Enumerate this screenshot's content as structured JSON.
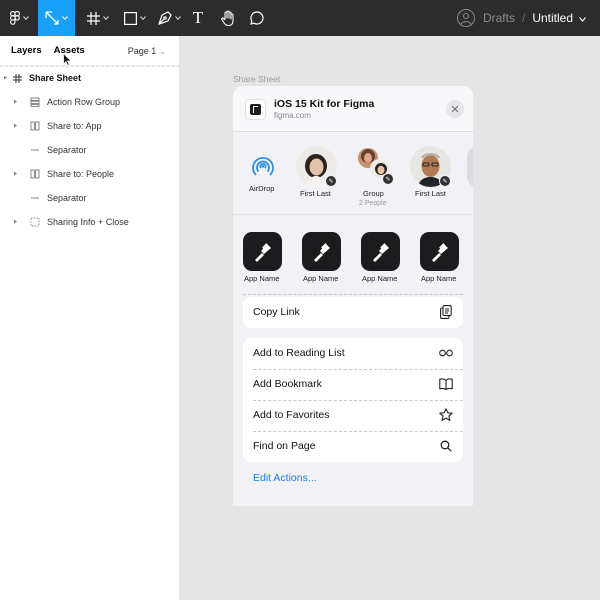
{
  "toolbar": {
    "tools": [
      {
        "name": "main-menu",
        "icon": "figma-logo-icon"
      },
      {
        "name": "move-tool",
        "icon": "move-arrow-icon",
        "active": true
      },
      {
        "name": "frame-tool",
        "icon": "frame-hash-icon"
      },
      {
        "name": "shape-tool",
        "icon": "rectangle-icon"
      },
      {
        "name": "pen-tool",
        "icon": "pen-icon"
      },
      {
        "name": "text-tool",
        "icon": "text-t-icon",
        "glyph": "T"
      },
      {
        "name": "hand-tool",
        "icon": "hand-icon"
      },
      {
        "name": "comment-tool",
        "icon": "comment-bubble-icon"
      }
    ],
    "breadcrumb_root": "Drafts",
    "breadcrumb_sep": "/",
    "file_title": "Untitled",
    "active_color": "#18a0fb",
    "bg_color": "#2c2c2c"
  },
  "left_panel": {
    "tabs": [
      "Layers",
      "Assets"
    ],
    "active_tab": "Assets",
    "page_select": "Page 1",
    "layers": [
      {
        "label": "Share Sheet",
        "kind": "frame",
        "level": 0,
        "expandable": true
      },
      {
        "label": "Action Row Group",
        "kind": "group",
        "level": 1,
        "expandable": true
      },
      {
        "label": "Share to: App",
        "kind": "component",
        "level": 1,
        "expandable": true
      },
      {
        "label": "Separator",
        "kind": "line",
        "level": 1,
        "expandable": false
      },
      {
        "label": "Share to: People",
        "kind": "component",
        "level": 1,
        "expandable": true
      },
      {
        "label": "Separator",
        "kind": "line",
        "level": 1,
        "expandable": false
      },
      {
        "label": "Sharing Info + Close",
        "kind": "dashed-frame",
        "level": 1,
        "expandable": true
      }
    ]
  },
  "canvas": {
    "frame_label": "Share Sheet",
    "header": {
      "title": "iOS 15 Kit for Figma",
      "subtitle": "figma.com",
      "close_glyph": "✕"
    },
    "people": [
      {
        "name": "AirDrop",
        "sub": "",
        "kind": "airdrop"
      },
      {
        "name": "First Last",
        "sub": "",
        "kind": "person"
      },
      {
        "name": "Group",
        "sub": "2 People",
        "kind": "group"
      },
      {
        "name": "First Last",
        "sub": "",
        "kind": "person"
      }
    ],
    "apps": [
      {
        "name": "App Name"
      },
      {
        "name": "App Name"
      },
      {
        "name": "App Name"
      },
      {
        "name": "App Name"
      }
    ],
    "copy_link": {
      "label": "Copy Link",
      "icon": "copy-doc-icon"
    },
    "actions": [
      {
        "label": "Add to Reading List",
        "icon": "glasses-icon"
      },
      {
        "label": "Add Bookmark",
        "icon": "book-icon"
      },
      {
        "label": "Add to Favorites",
        "icon": "star-icon"
      },
      {
        "label": "Find on Page",
        "icon": "search-icon"
      }
    ],
    "edit_actions": "Edit Actions...",
    "link_color": "#1c7ee0",
    "airdrop_color": "#2c8fe6"
  }
}
